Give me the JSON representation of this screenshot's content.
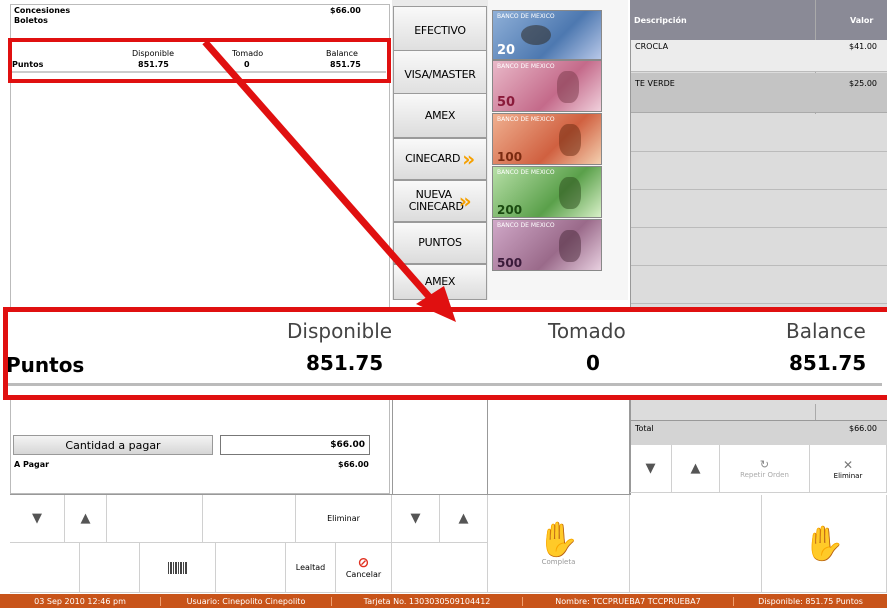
{
  "top_summary": {
    "concesiones_label": "Concesiones",
    "concesiones_value": "$66.00",
    "boletos_label": "Boletos"
  },
  "points_small": {
    "col_disponible": "Disponible",
    "col_tomado": "Tomado",
    "col_balance": "Balance",
    "row_label": "Puntos",
    "disponible": "851.75",
    "tomado": "0",
    "balance": "851.75"
  },
  "points_zoom": {
    "col_disponible": "Disponible",
    "col_tomado": "Tomado",
    "col_balance": "Balance",
    "row_label": "Puntos",
    "disponible": "851.75",
    "tomado": "0",
    "balance": "851.75"
  },
  "payment_methods": [
    "EFECTIVO",
    "VISA/MASTER",
    "AMEX",
    "CINECARD",
    "NUEVA CINECARD",
    "PUNTOS",
    "AMEX"
  ],
  "banknotes": [
    "20",
    "50",
    "100",
    "200",
    "500"
  ],
  "banknote_bank": "BANCO DE MEXICO",
  "order_table": {
    "col_descripcion": "Descripción",
    "col_valor": "Valor",
    "rows": [
      {
        "desc": "CROCLA",
        "value": "$41.00"
      },
      {
        "desc": "TE VERDE",
        "value": "$25.00"
      }
    ],
    "total_label": "Total",
    "total_value": "$66.00"
  },
  "payment_summary": {
    "cantidad_button": "Cantidad a pagar",
    "cantidad_value": "$66.00",
    "a_pagar_label": "A Pagar",
    "a_pagar_value": "$66.00"
  },
  "controls": {
    "eliminar": "Eliminar",
    "lealtad": "Lealtad",
    "cancelar": "Cancelar",
    "completa": "Completa",
    "repetir_orden": "Repetir Orden",
    "eliminar_right": "Eliminar"
  },
  "status_bar": {
    "fecha": "03 Sep 2010 12:46 pm",
    "usuario": "Usuario:  Cinepolito  Cinepolito",
    "tarjeta": "Tarjeta No.  1303030509104412",
    "nombre": "Nombre:  TCCPRUEBA7  TCCPRUEBA7",
    "disponible": "Disponible:  851.75 Puntos"
  },
  "colors": {
    "highlight_red": "#e01010",
    "status_orange": "#c8541a",
    "chevron_orange": "#f5a000"
  }
}
